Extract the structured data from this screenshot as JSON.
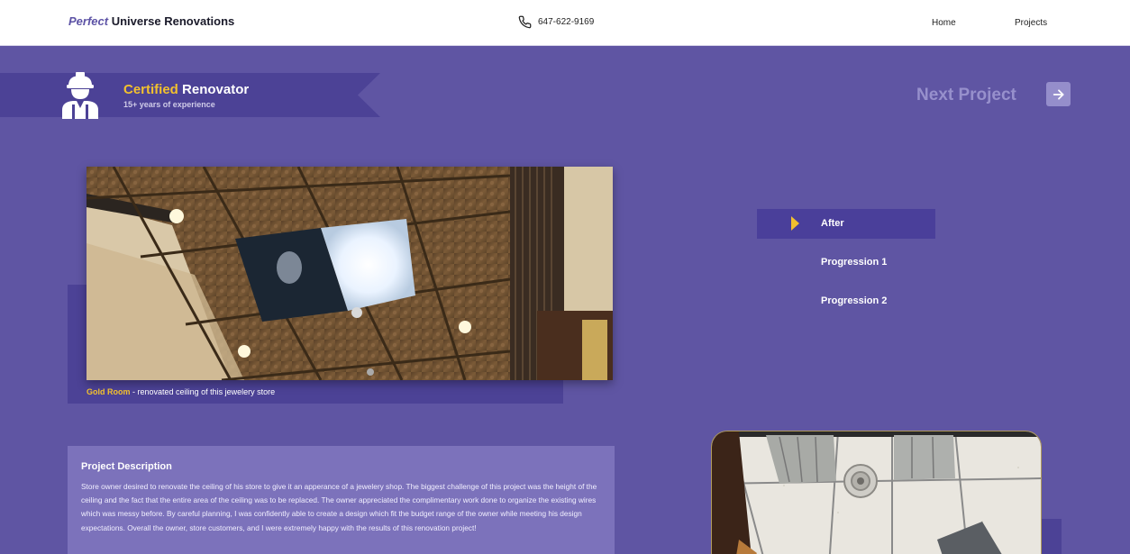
{
  "header": {
    "brand_prefix": "Perfect",
    "brand_name": "Universe Renovations",
    "phone_icon": "phone-icon",
    "phone": "647-622-9169",
    "nav": [
      {
        "label": "Home"
      },
      {
        "label": "Projects"
      }
    ]
  },
  "badge": {
    "icon": "construction-worker-icon",
    "title_highlight": "Certified",
    "title_rest": "Renovator",
    "subtitle": "15+ years of experience"
  },
  "next_project": {
    "label": "Next Project",
    "icon": "arrow-right-icon"
  },
  "gallery": {
    "caption_title": "Gold Room",
    "caption_separator": "-",
    "caption_text": "renovated ceiling of this jewelery store",
    "tabs": [
      {
        "label": "After",
        "active": true
      },
      {
        "label": "Progression 1",
        "active": false
      },
      {
        "label": "Progression 2",
        "active": false
      }
    ]
  },
  "description": {
    "title": "Project Description",
    "body": "Store owner desired to renovate the ceiling of his store to give it an apperance of a jewelery shop. The biggest challenge of this project was the height of the ceiling and the fact that the entire area of the ceiling was to be replaced. The owner appreciated the complimentary work done to organize the existing wires which was messy before. By careful planning, I was confidently able to create a design which fit the budget range of the owner while meeting his design expectations. Overall the owner, store customers, and I were extremely happy with the results of this renovation project!"
  },
  "colors": {
    "background": "#5f55a3",
    "accent_gold": "#f2c12e",
    "brand_purple": "#5d53a6",
    "tab_active": "#4a3f9a"
  }
}
